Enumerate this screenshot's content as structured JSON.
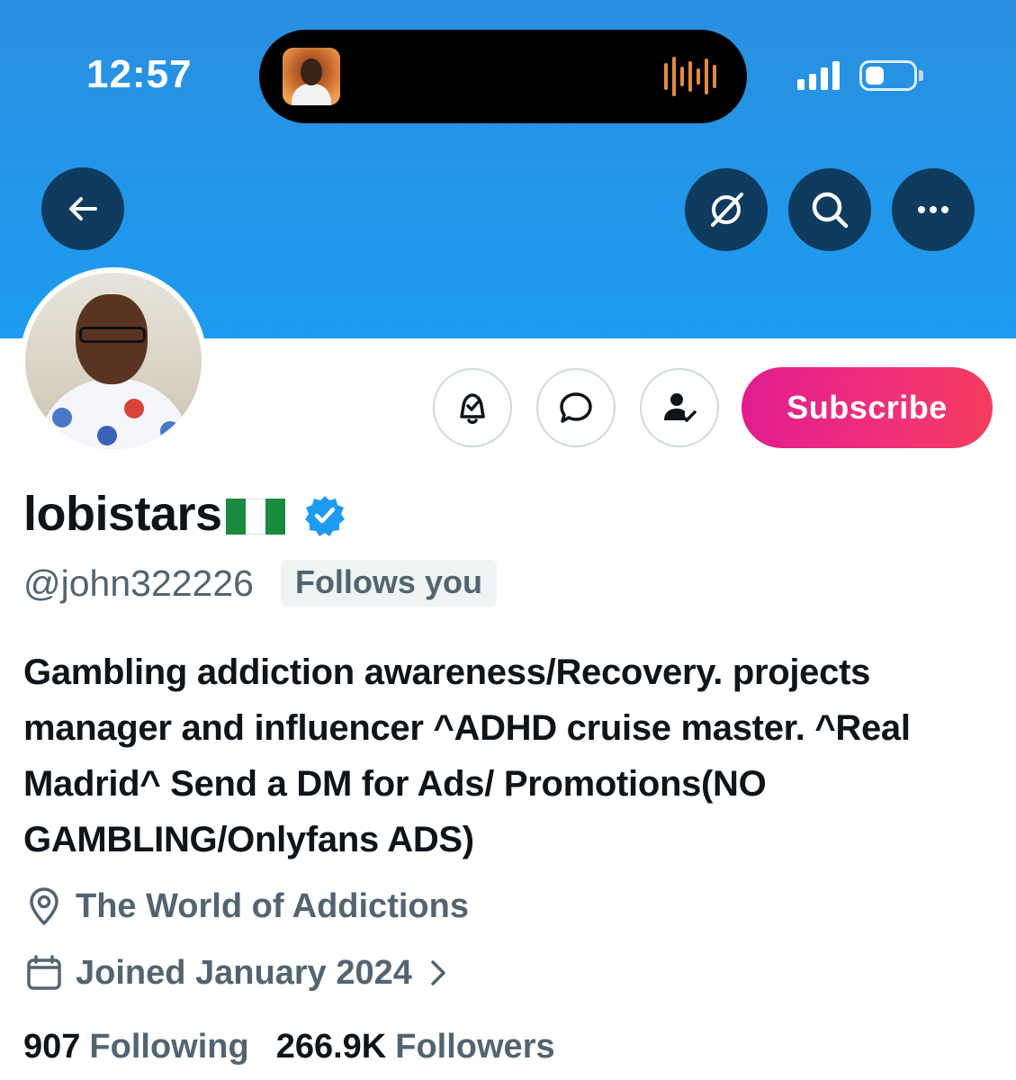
{
  "status_bar": {
    "time": "12:57"
  },
  "header": {
    "back_icon": "arrow-left-icon",
    "actions": [
      {
        "name": "grok-icon"
      },
      {
        "name": "search-icon"
      },
      {
        "name": "more-icon"
      }
    ]
  },
  "profile": {
    "display_name": "lobistars",
    "flag": "nigeria-flag",
    "verified": true,
    "handle": "@john322226",
    "follows_you_label": "Follows you",
    "bio": "Gambling addiction awareness/Recovery. projects manager and influencer ^ADHD cruise master. ^Real Madrid^ Send a DM for Ads/ Promotions(NO GAMBLING/Onlyfans ADS)",
    "location": "The World of Addictions",
    "joined": "Joined January 2024",
    "following_count": "907",
    "following_label": "Following",
    "followers_count": "266.9K",
    "followers_label": "Followers"
  },
  "actions": {
    "subscribe_label": "Subscribe",
    "icons": [
      "bell-check-icon",
      "message-icon",
      "user-following-icon"
    ]
  },
  "colors": {
    "banner": "#1d9bf0",
    "subscribe_start": "#e11d8f",
    "subscribe_end": "#f53d5c",
    "verified": "#1d9bf0",
    "secondary_text": "#536471"
  }
}
